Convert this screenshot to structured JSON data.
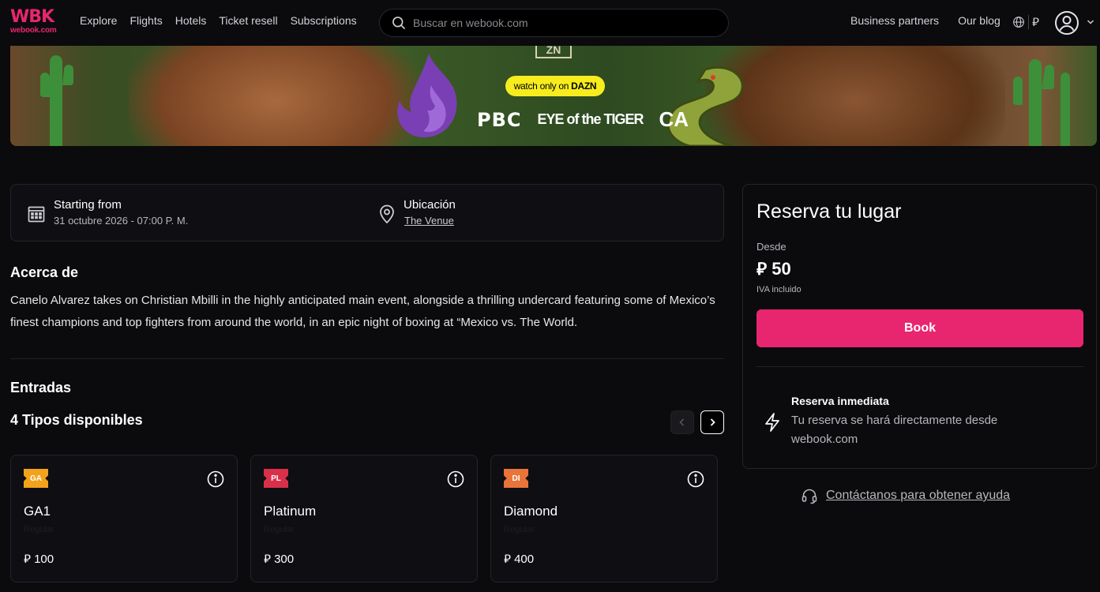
{
  "header": {
    "logo_mark": "WBK",
    "logo_sub": "webook.com",
    "nav": [
      "Explore",
      "Flights",
      "Hotels",
      "Ticket resell",
      "Subscriptions"
    ],
    "search_placeholder": "Buscar en webook.com",
    "business_partners": "Business partners",
    "our_blog": "Our blog",
    "currency_symbol": "⃁"
  },
  "banner": {
    "zn": "ZN",
    "dazn_prefix": "watch only on",
    "dazn_brand": "DAZN",
    "brands": [
      "PBC",
      "EYE of the TIGER",
      "CA"
    ]
  },
  "event_info": {
    "start_label": "Starting from",
    "start_value": "31 octubre 2026 - 07:00 P. M.",
    "location_label": "Ubicación",
    "location_value": "The Venue"
  },
  "about": {
    "title": "Acerca de",
    "text": "Canelo Alvarez takes on Christian Mbilli in the highly anticipated main event, alongside a thrilling undercard featuring some of Mexico’s finest champions and top fighters from around the world, in an epic night of boxing at “Mexico vs. The World."
  },
  "tickets": {
    "title": "Entradas",
    "types_title": "4 Tipos disponibles",
    "items": [
      {
        "code": "GA",
        "name": "GA1",
        "sub": "Regular",
        "price": "100",
        "color": "#f2a31b"
      },
      {
        "code": "PL",
        "name": "Platinum",
        "sub": "Regular",
        "price": "300",
        "color": "#d9304a"
      },
      {
        "code": "DI",
        "name": "Diamond",
        "sub": "Regular",
        "price": "400",
        "color": "#e8743a"
      }
    ]
  },
  "booking": {
    "title": "Reserva tu lugar",
    "from_label": "Desde",
    "price": "50",
    "vat_note": "IVA incluido",
    "cta": "Book",
    "instant_title": "Reserva inmediata",
    "instant_text": "Tu reserva se hará directamente desde webook.com"
  },
  "help": {
    "label": "Contáctanos para obtener ayuda"
  },
  "colors": {
    "accent": "#e8266f",
    "background": "#0b0a0d",
    "card": "#0f0e12"
  }
}
